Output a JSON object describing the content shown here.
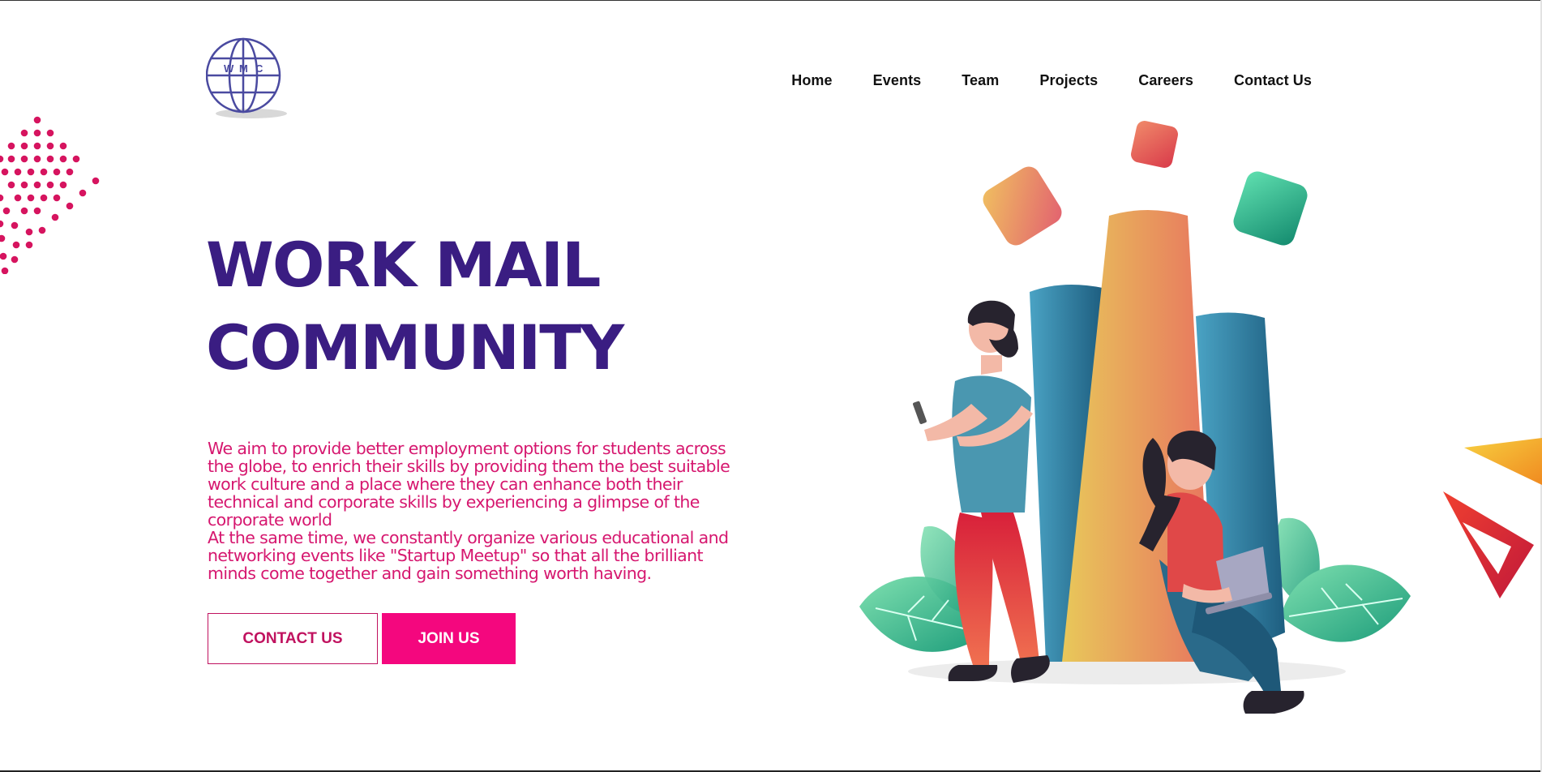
{
  "logo": {
    "letters": [
      "W",
      "M",
      "C"
    ]
  },
  "nav": {
    "items": [
      "Home",
      "Events",
      "Team",
      "Projects",
      "Careers",
      "Contact Us"
    ]
  },
  "hero": {
    "title_line1": "WORK MAIL",
    "title_line2": "COMMUNITY",
    "description_lines": [
      "We aim to provide better employment options for students across",
      "the globe, to enrich their skills by providing them the best suitable",
      "work culture and a place where they can enhance both their",
      "technical and corporate skills by experiencing a glimpse of the",
      "corporate world",
      "At the same time, we constantly organize various educational and",
      "networking events like \"Startup Meetup\" so that all the brilliant",
      "minds come together and gain something worth having."
    ]
  },
  "buttons": {
    "contact_label": "CONTACT US",
    "join_label": "JOIN US"
  },
  "colors": {
    "title": "#3a1d82",
    "accent_pink": "#f4077e",
    "description": "#d6176f",
    "logo_blue": "#4a4aa0"
  }
}
